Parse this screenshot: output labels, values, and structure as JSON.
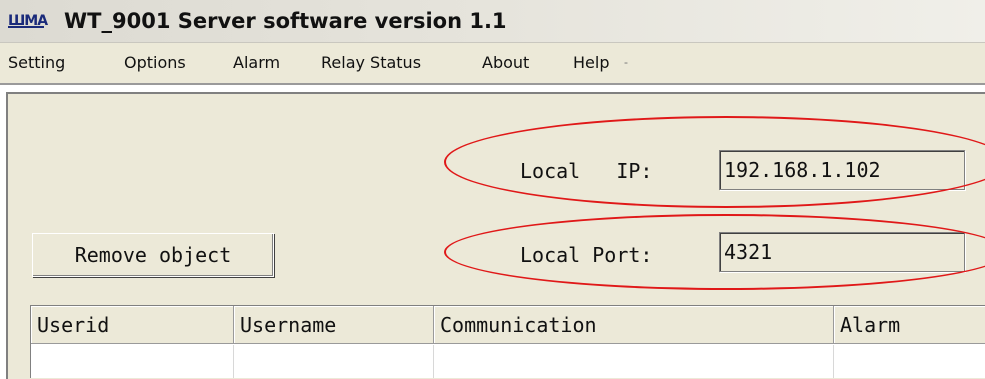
{
  "window": {
    "icon_text": "WMA",
    "title": "WT_9001 Server software version 1.1"
  },
  "menu": {
    "items": [
      "Setting",
      "Options",
      "Alarm",
      "Relay Status",
      "About",
      "Help"
    ],
    "trailing_mark": "-"
  },
  "network": {
    "ip_label": "Local   IP:",
    "ip_value": "192.168.1.102",
    "port_label": "Local Port:",
    "port_value": "4321"
  },
  "actions": {
    "remove_label": "Remove object"
  },
  "table": {
    "columns": [
      "Userid",
      "Username",
      "Communication",
      "Alarm"
    ],
    "rows": []
  },
  "colors": {
    "highlight": "#e01818",
    "window_bg": "#ece9d8"
  }
}
